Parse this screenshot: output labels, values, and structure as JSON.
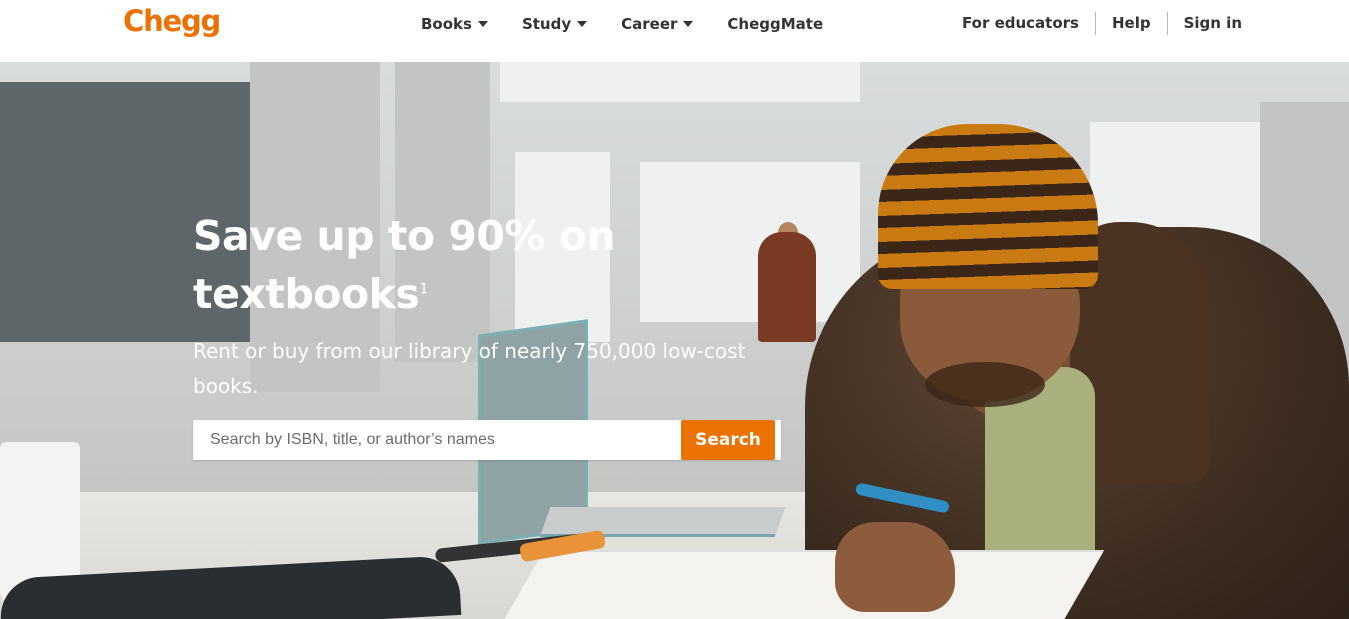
{
  "brand": {
    "logo": "Chegg",
    "accent": "#eb7100"
  },
  "nav": {
    "items": [
      {
        "label": "Books",
        "dropdown": true
      },
      {
        "label": "Study",
        "dropdown": true
      },
      {
        "label": "Career",
        "dropdown": true
      },
      {
        "label": "CheggMate",
        "dropdown": false
      }
    ],
    "right": [
      "For educators",
      "Help",
      "Sign in"
    ]
  },
  "hero": {
    "title": "Save up to 90% on textbooks",
    "title_sup": "1",
    "subtitle": "Rent or buy from our library of nearly 750,000 low-cost books.",
    "search": {
      "placeholder": "Search by ISBN, title, or author’s names",
      "value": "",
      "button": "Search"
    }
  }
}
